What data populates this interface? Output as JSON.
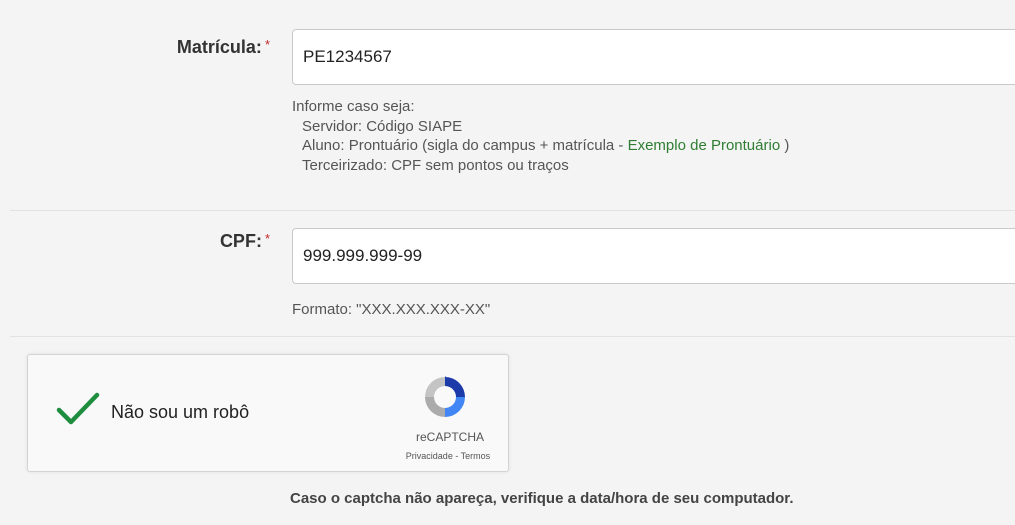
{
  "form": {
    "matricula": {
      "label": "Matrícula:",
      "required_mark": "*",
      "value": "PE1234567",
      "help": {
        "intro": "Informe caso seja:",
        "servidor": "Servidor: Código SIAPE",
        "aluno_prefix": "Aluno: Prontuário (sigla do campus + matrícula - ",
        "aluno_link": "Exemplo de Prontuário",
        "aluno_suffix": " )",
        "terceirizado": "Terceirizado: CPF sem pontos ou traços"
      }
    },
    "cpf": {
      "label": "CPF:",
      "required_mark": "*",
      "value": "999.999.999-99",
      "help": "Formato: \"XXX.XXX.XXX-XX\""
    }
  },
  "captcha": {
    "label": "Não sou um robô",
    "checked": true,
    "brand": "reCAPTCHA",
    "privacy": "Privacidade",
    "separator": " - ",
    "terms": "Termos",
    "note": "Caso o captcha não apareça, verifique a data/hora de seu computador."
  },
  "colors": {
    "check": "#1e8e3e",
    "link": "#2e7d32",
    "required": "#c62828"
  },
  "icons": [
    "check-icon",
    "recaptcha-logo-icon"
  ]
}
